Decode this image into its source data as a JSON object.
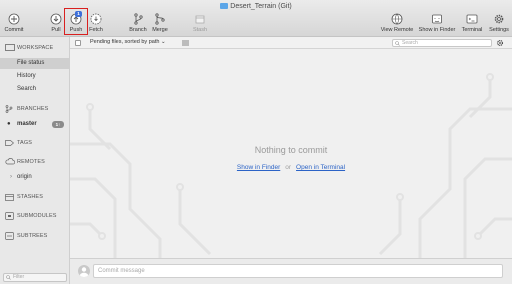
{
  "window": {
    "title": "Desert_Terrain (Git)"
  },
  "toolbar": {
    "commit": "Commit",
    "pull": "Pull",
    "push": "Push",
    "push_badge": "1",
    "fetch": "Fetch",
    "branch": "Branch",
    "merge": "Merge",
    "stash": "Stash",
    "view_remote": "View Remote",
    "show_in_finder": "Show in Finder",
    "terminal": "Terminal",
    "settings": "Settings"
  },
  "subbar": {
    "sort_label": "Pending files, sorted by path",
    "search_placeholder": "Search"
  },
  "sidebar": {
    "workspace": "WORKSPACE",
    "workspace_items": [
      "File status",
      "History",
      "Search"
    ],
    "branches": "BRANCHES",
    "branch_name": "master",
    "branch_badge": "1↑",
    "tags": "TAGS",
    "remotes": "REMOTES",
    "remote_name": "origin",
    "stashes": "STASHES",
    "submodules": "SUBMODULES",
    "subtrees": "SUBTREES",
    "filter_placeholder": "Filter"
  },
  "main": {
    "empty_message": "Nothing to commit",
    "show_in_finder_link": "Show in Finder",
    "or_text": "or",
    "open_in_terminal_link": "Open in Terminal"
  },
  "commit": {
    "message_placeholder": "Commit message"
  },
  "colors": {
    "accent": "#2b63c6",
    "highlight": "#d9201f",
    "badge": "#3d6fd9"
  }
}
